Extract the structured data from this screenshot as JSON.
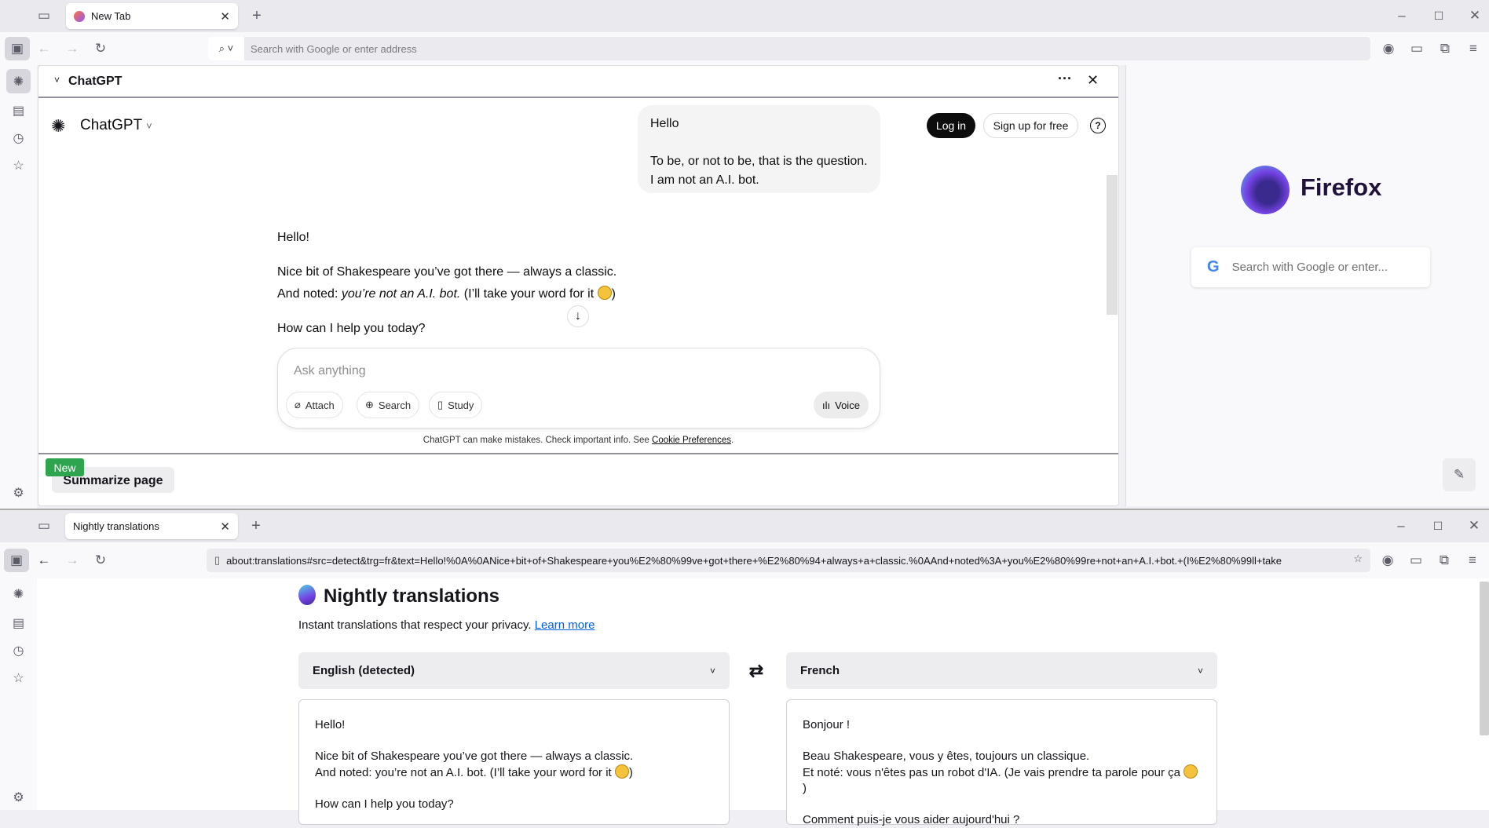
{
  "top": {
    "tab_title": "New Tab",
    "url_placeholder": "Search with Google or enter address",
    "chat_panel": {
      "title": "ChatGPT",
      "brand": "ChatGPT",
      "login": "Log in",
      "signup": "Sign up for free",
      "help": "?",
      "user_message": {
        "line1": "Hello",
        "line2": "To be, or not to be, that is the question.",
        "line3": "I am not an A.I. bot."
      },
      "assistant": {
        "greeting": "Hello!",
        "line1": "Nice bit of Shakespeare you’ve got there — always a classic.",
        "line2_prefix": "And noted: ",
        "line2_em": "you’re not an A.I. bot.",
        "line2_suffix": " (I’ll take your word for it ",
        "line2_end": ")",
        "question": "How can I help you today?"
      },
      "input_placeholder": "Ask anything",
      "attach": "Attach",
      "search": "Search",
      "study": "Study",
      "voice": "Voice",
      "disclaimer": "ChatGPT can make mistakes. Check important info. See ",
      "cookie_link": "Cookie Preferences",
      "disclaimer_end": ".",
      "new_badge": "New",
      "summarize": "Summarize page"
    },
    "newtab": {
      "brand": "Firefox",
      "search_placeholder": "Search with Google or enter..."
    }
  },
  "bottom": {
    "tab_title": "Nightly translations",
    "url": "about:translations#src=detect&trg=fr&text=Hello!%0A%0ANice+bit+of+Shakespeare+you%E2%80%99ve+got+there+%E2%80%94+always+a+classic.%0AAnd+noted%3A+you%E2%80%99re+not+an+A.I.+bot.+(I%E2%80%99ll+take",
    "page_title": "Nightly translations",
    "subtitle": "Instant translations that respect your privacy. ",
    "learn_more": "Learn more",
    "source_lang": "English (detected)",
    "target_lang": "French",
    "source_text": {
      "l1": "Hello!",
      "l2": "Nice bit of Shakespeare you’ve got there — always a classic.",
      "l3": "And noted: you’re not an A.I. bot. (I’ll take your word for it ",
      "l3end": ")",
      "l4": "How can I help you today?"
    },
    "target_text": {
      "l1": "Bonjour !",
      "l2": "Beau Shakespeare, vous y êtes, toujours un classique.",
      "l3": "Et noté: vous n'êtes pas un robot d'IA. (Je vais prendre ta parole pour ça ",
      "l3end": ")",
      "l4": "Comment puis-je vous aider aujourd'hui ?"
    }
  },
  "colors": {
    "accent_link": "#0061e0",
    "badge_green": "#2ea44f",
    "login_bg": "#0d0d0d"
  }
}
